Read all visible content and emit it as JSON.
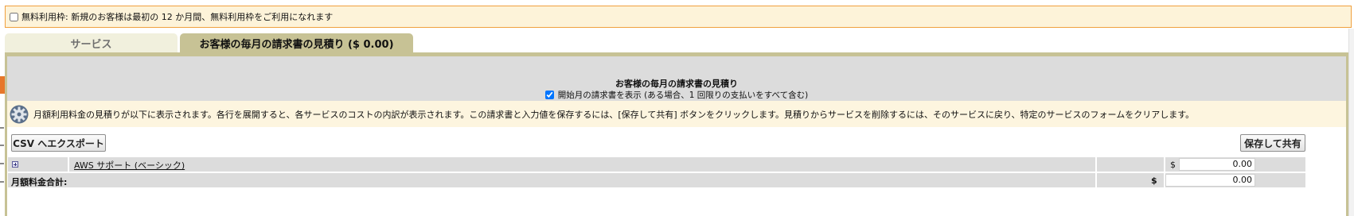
{
  "free_tier": {
    "text": "無料利用枠: 新規のお客様は最初の 12 か月間、無料利用枠をご利用になれます",
    "checked": false
  },
  "tabs": [
    {
      "label": "サービス",
      "active": false
    },
    {
      "label": "お客様の毎月の請求書の見積り ($ 0.00)",
      "active": true
    }
  ],
  "estimate": {
    "title": "お客様の毎月の請求書の見積り",
    "show_first_month_label": "開始月の請求書を表示 (ある場合、1 回限りの支払いをすべて含む)",
    "show_first_month_checked": true,
    "info_text": "月額利用料金の見積りが以下に表示されます。各行を展開すると、各サービスのコストの内訳が表示されます。この請求書と入力値を保存するには、[保存して共有] ボタンをクリックします。見積りからサービスを削除するには、そのサービスに戻り、特定のサービスのフォームをクリアします。",
    "info_icon": "gear-icon",
    "export_button": "CSV へエクスポート",
    "save_button": "保存して共有",
    "rows": [
      {
        "name": "AWS サポート (ベーシック)",
        "currency": "$",
        "amount": "0.00"
      }
    ],
    "total": {
      "label": "月額料金合計:",
      "currency": "$",
      "amount": "0.00"
    }
  },
  "colors": {
    "tab_active": "#c7c295",
    "tab_inactive": "#f1f0dd",
    "notice_bg": "#fdf3d9",
    "notice_border": "#f0a03e",
    "header_gray": "#dcdcdc"
  }
}
